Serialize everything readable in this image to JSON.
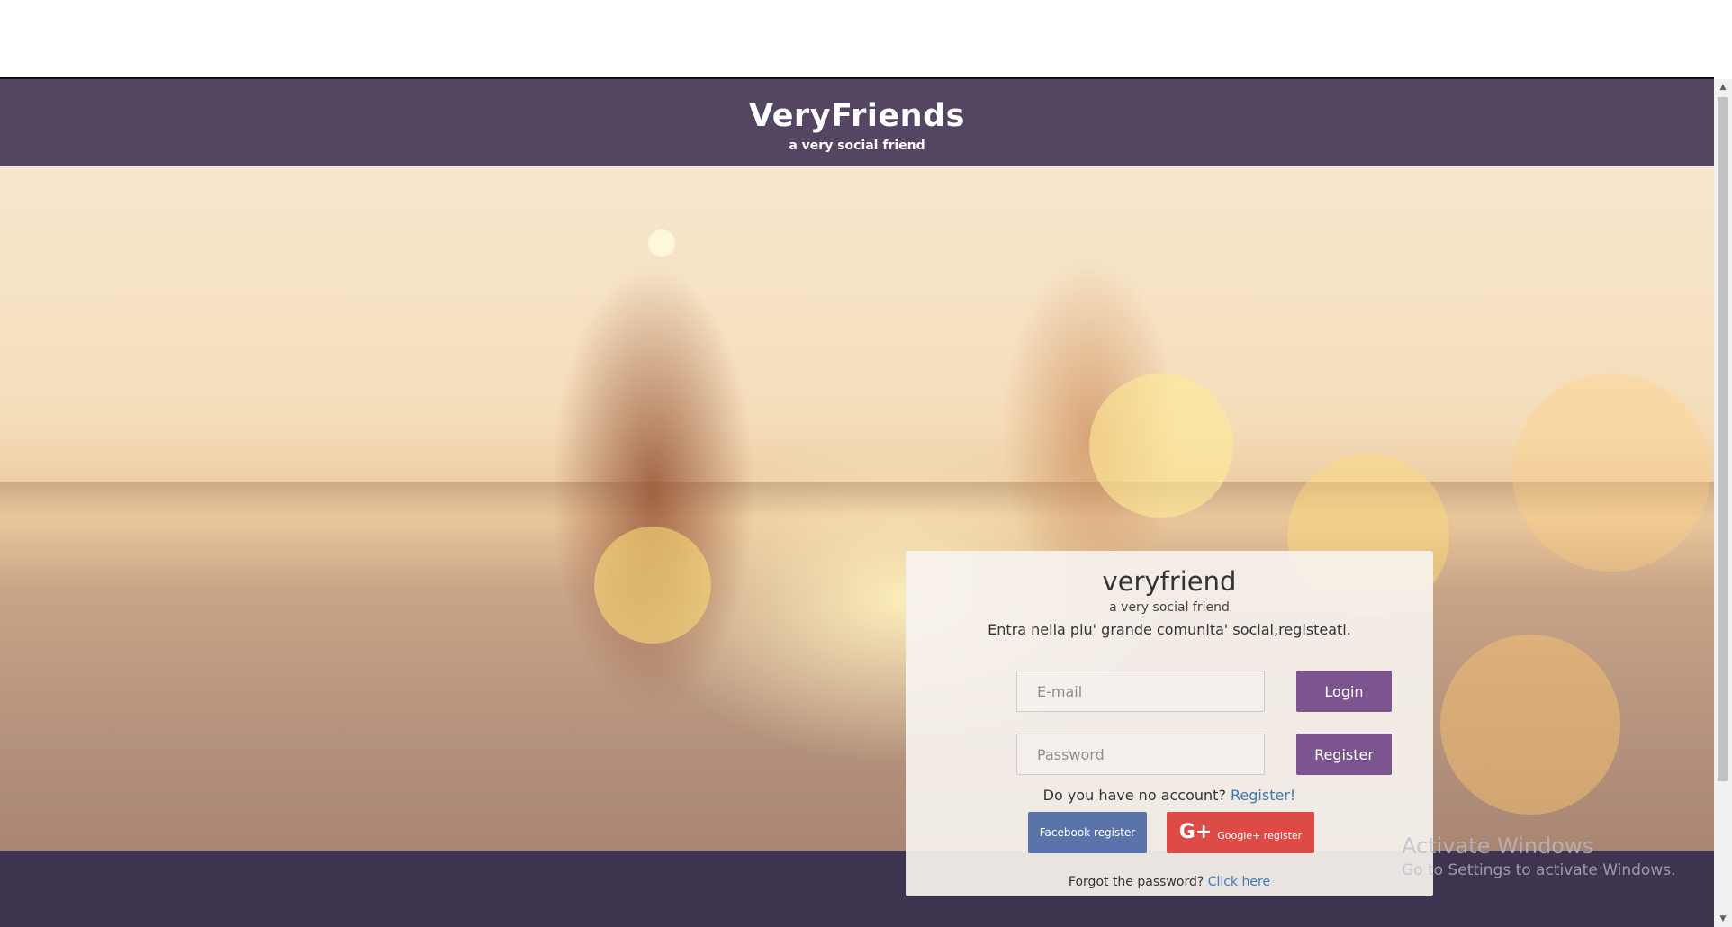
{
  "header": {
    "title": "VeryFriends",
    "subtitle": "a very social friend"
  },
  "login_card": {
    "title": "veryfriend",
    "subtitle": "a very social friend",
    "description": "Entra nella piu' grande comunita' social,registeati.",
    "email_placeholder": "E-mail",
    "password_placeholder": "Password",
    "login_label": "Login",
    "register_label": "Register",
    "no_account_text": "Do you have no account?",
    "register_link": "Register!",
    "facebook_label": "Facebook register",
    "google_icon": "G+",
    "google_label": "Google+ register",
    "forgot_text": "Forgot the password?",
    "forgot_link": "Click here"
  },
  "watermark": {
    "title": "Activate Windows",
    "subtitle": "Go to Settings to activate Windows."
  },
  "scrollbar": {
    "up_icon": "▲",
    "down_icon": "▼"
  },
  "colors": {
    "header_bg": "#544562",
    "footer_bg": "#3f3450",
    "button_purple": "#7c5490",
    "facebook_blue": "#5a73aa",
    "google_red": "#dd4b46",
    "link_blue": "#3f79b5"
  },
  "icons": {
    "google": "google-plus-icon",
    "scroll_up": "arrow-up-icon",
    "scroll_down": "arrow-down-icon"
  }
}
